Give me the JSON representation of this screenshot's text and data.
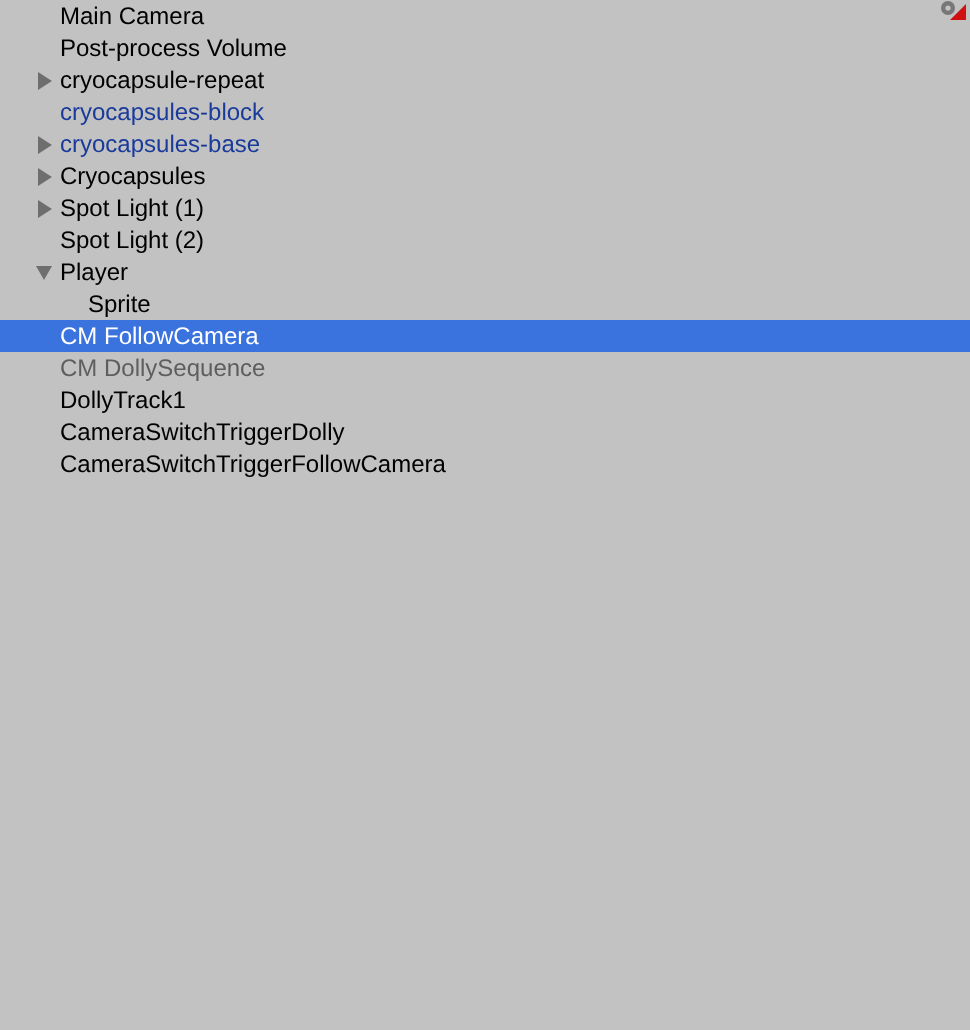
{
  "items": [
    {
      "label": "Main Camera",
      "selected": false
    },
    {
      "label": "Post-process Volume",
      "selected": false
    },
    {
      "label": "cryocapsule-repeat",
      "selected": false,
      "expanded": false
    },
    {
      "label": "cryocapsules-block",
      "kind": "prefab",
      "selected": false
    },
    {
      "label": "cryocapsules-base",
      "kind": "prefab",
      "selected": false,
      "expanded": false
    },
    {
      "label": "Cryocapsules",
      "selected": false,
      "expanded": false
    },
    {
      "label": "Spot Light (1)",
      "selected": false,
      "expanded": false
    },
    {
      "label": "Spot Light (2)",
      "selected": false
    },
    {
      "label": "Player",
      "selected": false,
      "expanded": true,
      "children": [
        {
          "label": "Sprite",
          "selected": false
        }
      ]
    },
    {
      "label": "CM FollowCamera",
      "selected": true
    },
    {
      "label": "CM DollySequence",
      "kind": "inactive",
      "selected": false
    },
    {
      "label": "DollyTrack1",
      "selected": false
    },
    {
      "label": "CameraSwitchTriggerDolly",
      "selected": false
    },
    {
      "label": "CameraSwitchTriggerFollowCamera",
      "selected": false
    }
  ]
}
